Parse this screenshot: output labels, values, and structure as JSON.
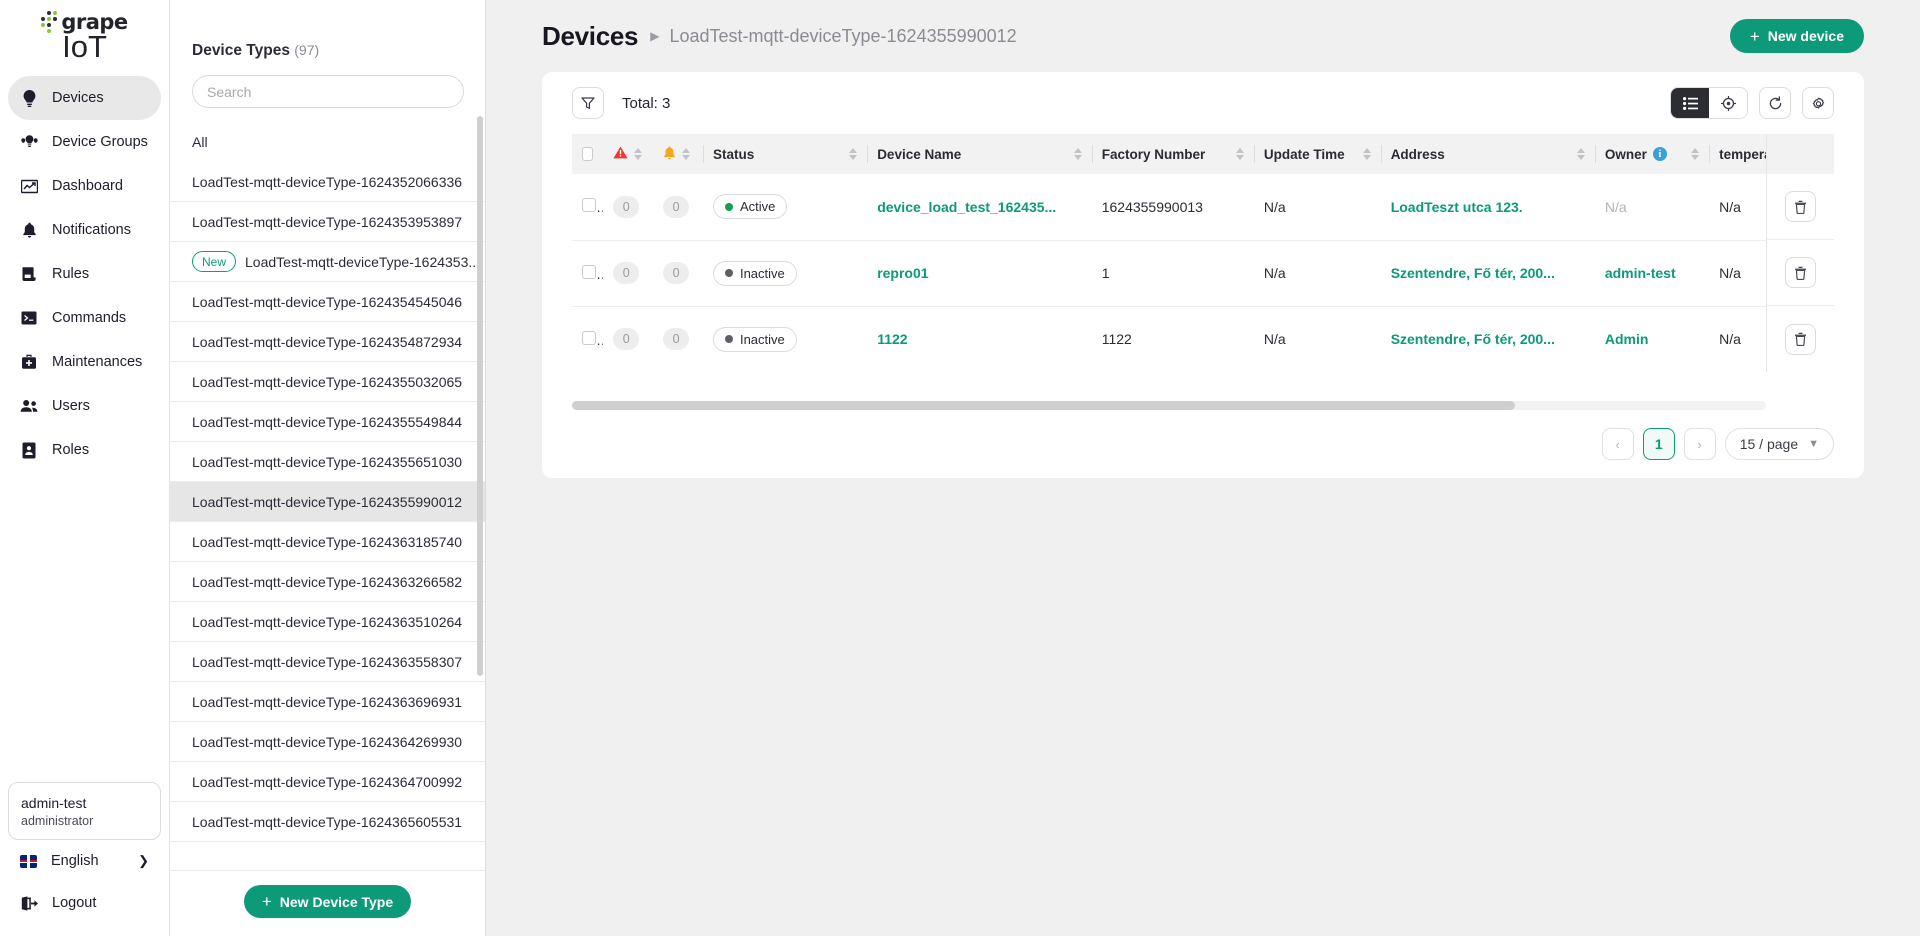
{
  "brand": {
    "word": "grape",
    "sub": "IoT"
  },
  "nav": {
    "items": [
      {
        "label": "Devices",
        "icon": "lightbulb-icon",
        "active": true
      },
      {
        "label": "Device Groups",
        "icon": "device-groups-icon",
        "active": false
      },
      {
        "label": "Dashboard",
        "icon": "chart-icon",
        "active": false
      },
      {
        "label": "Notifications",
        "icon": "bell-icon",
        "active": false
      },
      {
        "label": "Rules",
        "icon": "rules-icon",
        "active": false
      },
      {
        "label": "Commands",
        "icon": "terminal-icon",
        "active": false
      },
      {
        "label": "Maintenances",
        "icon": "toolbox-icon",
        "active": false
      },
      {
        "label": "Users",
        "icon": "users-icon",
        "active": false
      },
      {
        "label": "Roles",
        "icon": "badge-icon",
        "active": false
      }
    ],
    "user": {
      "name": "admin-test",
      "role": "administrator"
    },
    "language": "English",
    "logout": "Logout"
  },
  "device_types": {
    "title": "Device Types",
    "count": "(97)",
    "search_placeholder": "Search",
    "new_badge": "New",
    "new_button": "New Device Type",
    "items": [
      {
        "label": "All",
        "badge": "",
        "selected": false,
        "plain": true
      },
      {
        "label": "LoadTest-mqtt-deviceType-1624352066336",
        "badge": "",
        "selected": false
      },
      {
        "label": "LoadTest-mqtt-deviceType-1624353953897",
        "badge": "",
        "selected": false
      },
      {
        "label": "LoadTest-mqtt-deviceType-1624353...",
        "badge": "New",
        "selected": false
      },
      {
        "label": "LoadTest-mqtt-deviceType-1624354545046",
        "badge": "",
        "selected": false
      },
      {
        "label": "LoadTest-mqtt-deviceType-1624354872934",
        "badge": "",
        "selected": false
      },
      {
        "label": "LoadTest-mqtt-deviceType-1624355032065",
        "badge": "",
        "selected": false
      },
      {
        "label": "LoadTest-mqtt-deviceType-1624355549844",
        "badge": "",
        "selected": false
      },
      {
        "label": "LoadTest-mqtt-deviceType-1624355651030",
        "badge": "",
        "selected": false
      },
      {
        "label": "LoadTest-mqtt-deviceType-1624355990012",
        "badge": "",
        "selected": true
      },
      {
        "label": "LoadTest-mqtt-deviceType-1624363185740",
        "badge": "",
        "selected": false
      },
      {
        "label": "LoadTest-mqtt-deviceType-1624363266582",
        "badge": "",
        "selected": false
      },
      {
        "label": "LoadTest-mqtt-deviceType-1624363510264",
        "badge": "",
        "selected": false
      },
      {
        "label": "LoadTest-mqtt-deviceType-1624363558307",
        "badge": "",
        "selected": false
      },
      {
        "label": "LoadTest-mqtt-deviceType-1624363696931",
        "badge": "",
        "selected": false
      },
      {
        "label": "LoadTest-mqtt-deviceType-1624364269930",
        "badge": "",
        "selected": false
      },
      {
        "label": "LoadTest-mqtt-deviceType-1624364700992",
        "badge": "",
        "selected": false
      },
      {
        "label": "LoadTest-mqtt-deviceType-1624365605531",
        "badge": "",
        "selected": false
      }
    ]
  },
  "header": {
    "title": "Devices",
    "breadcrumb": "LoadTest-mqtt-deviceType-1624355990012",
    "new_device_button": "New device"
  },
  "toolbar": {
    "filter_icon": "filter-icon",
    "total": "Total: 3",
    "view_list_icon": "list-view-icon",
    "view_map_icon": "map-view-icon",
    "refresh_icon": "refresh-icon",
    "settings_icon": "gear-icon"
  },
  "table": {
    "columns": [
      {
        "key": "select",
        "label": "",
        "sortable": false
      },
      {
        "key": "alarms",
        "label": "",
        "icon": "warning-icon",
        "sortable": true
      },
      {
        "key": "notifs",
        "label": "",
        "icon": "bell-icon",
        "sortable": true
      },
      {
        "key": "status",
        "label": "Status",
        "sortable": true
      },
      {
        "key": "name",
        "label": "Device Name",
        "sortable": true
      },
      {
        "key": "factory",
        "label": "Factory Number",
        "sortable": true
      },
      {
        "key": "updated",
        "label": "Update Time",
        "sortable": true
      },
      {
        "key": "address",
        "label": "Address",
        "sortable": true
      },
      {
        "key": "owner",
        "label": "Owner",
        "sortable": true,
        "info": true
      },
      {
        "key": "temp",
        "label": "temperature_",
        "sortable": false
      }
    ],
    "rows": [
      {
        "alarms": "0",
        "notifs": "0",
        "status": "Active",
        "status_color": "#12a150",
        "name": "device_load_test_162435...",
        "factory": "1624355990013",
        "updated": "N/a",
        "address": "LoadTeszt utca 123.",
        "owner": "N/a",
        "temp": "N/a"
      },
      {
        "alarms": "0",
        "notifs": "0",
        "status": "Inactive",
        "status_color": "#5e5e66",
        "name": "repro01",
        "factory": "1",
        "updated": "N/a",
        "address": "Szentendre, Fő tér, 200...",
        "owner": "admin-test",
        "temp": "N/a"
      },
      {
        "alarms": "0",
        "notifs": "0",
        "status": "Inactive",
        "status_color": "#5e5e66",
        "name": "1122",
        "factory": "1122",
        "updated": "N/a",
        "address": "Szentendre, Fő tér, 200...",
        "owner": "Admin",
        "temp": "N/a"
      }
    ],
    "delete_icon": "trash-icon"
  },
  "pagination": {
    "prev": "‹",
    "next": "›",
    "current": "1",
    "page_size": "15 / page"
  },
  "colors": {
    "accent": "#0c9a79",
    "active": "#12a150",
    "inactive": "#5e5e66",
    "info": "#3aa0d6"
  }
}
